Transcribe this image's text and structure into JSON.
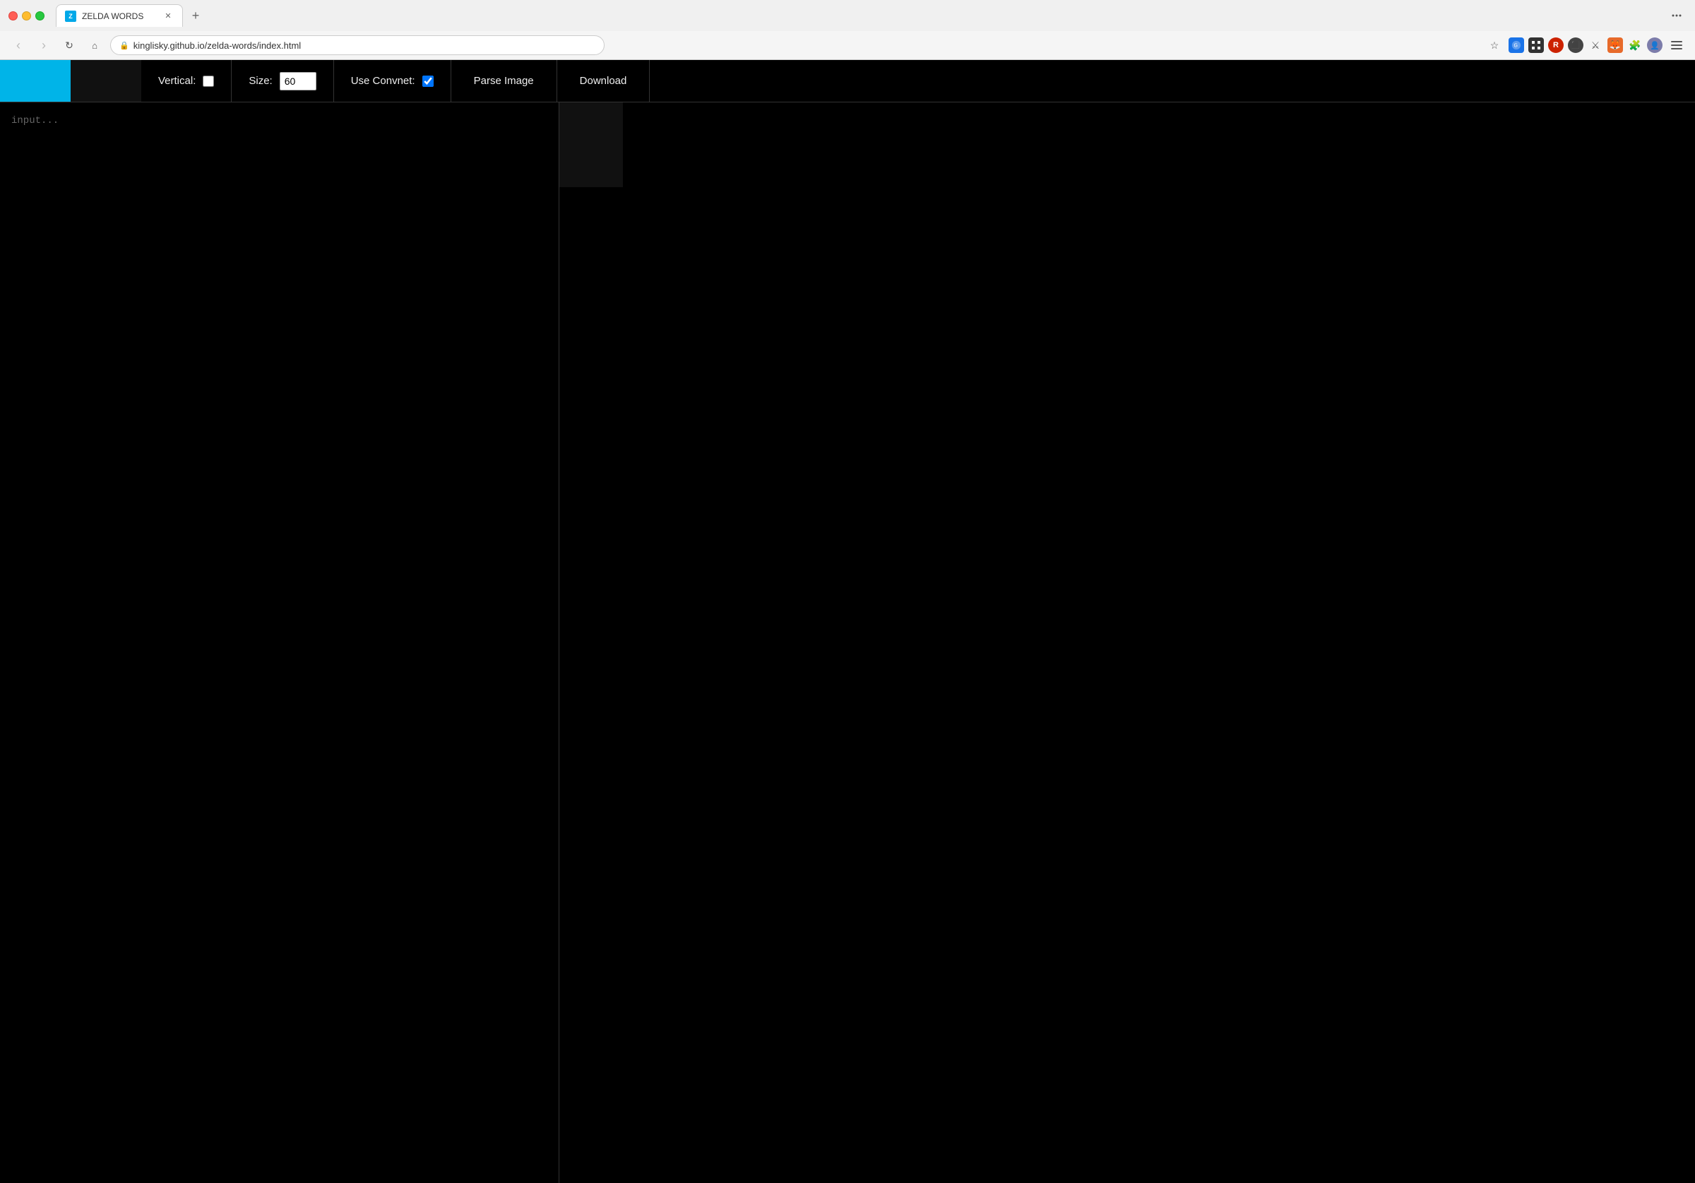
{
  "browser": {
    "tab_title": "ZELDA WORDS",
    "tab_favicon_text": "Z",
    "url": "kinglisky.github.io/zelda-words/index.html",
    "new_tab_label": "+",
    "nav": {
      "back": "‹",
      "forward": "›",
      "refresh": "↻",
      "home": "⌂"
    }
  },
  "toolbar": {
    "vertical_label": "Vertical:",
    "vertical_checked": false,
    "size_label": "Size:",
    "size_value": "60",
    "use_convnet_label": "Use Convnet:",
    "use_convnet_checked": true,
    "parse_image_label": "Parse Image",
    "download_label": "Download",
    "color_btn_blue": "",
    "color_btn_black": ""
  },
  "main": {
    "input_placeholder": "input..."
  }
}
